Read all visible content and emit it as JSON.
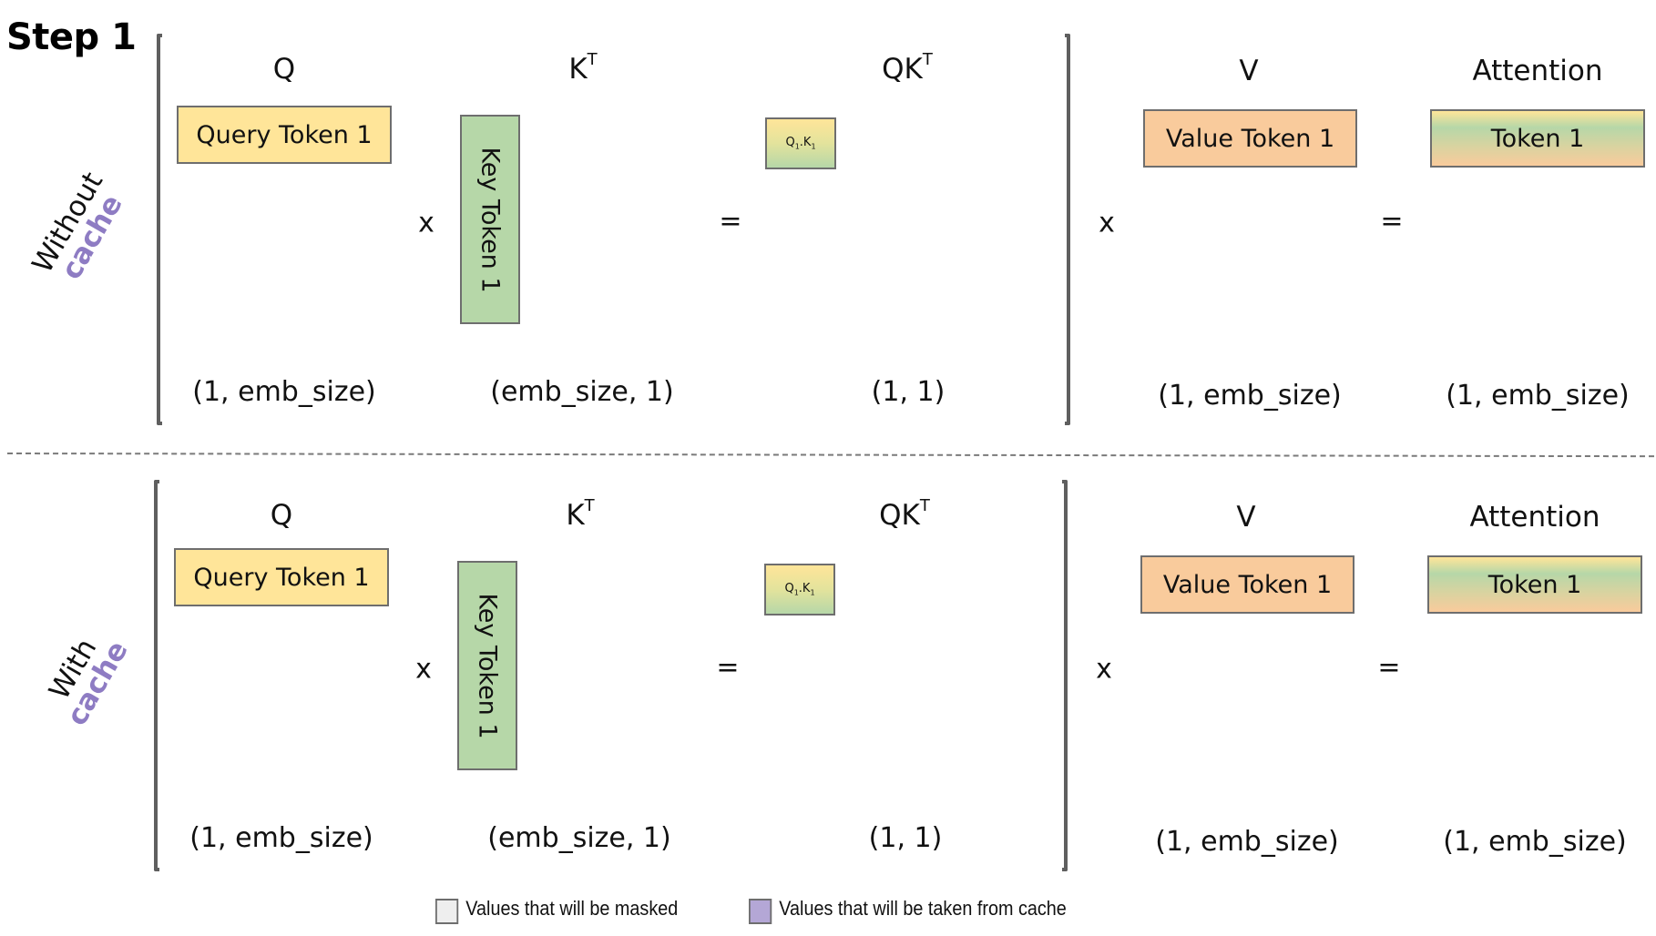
{
  "title": "Step 1",
  "colors": {
    "query": "#FFE599",
    "key": "#B6D7A8",
    "value": "#F9CB9C",
    "cache_accent": "#8E7CC3",
    "masked": "#EEEEEE",
    "from_cache": "#B4A7D6",
    "border": "#6E6E6E"
  },
  "panels": [
    {
      "id": "without-cache",
      "side_label": {
        "line1": "Without",
        "line2": "cache"
      },
      "q": {
        "header": "Q",
        "box_label": "Query Token 1",
        "dim": "(1, emb_size)"
      },
      "op_multiply_1": "x",
      "k": {
        "header_base": "K",
        "header_sup": "T",
        "box_label": "Key Token 1",
        "dim": "(emb_size, 1)"
      },
      "op_equals_1": "=",
      "qk": {
        "header_base": "QK",
        "header_sup": "T",
        "cell": {
          "q": "Q",
          "q_sub": "1",
          "sep": ".",
          "k": "K",
          "k_sub": "1"
        },
        "dim": "(1, 1)"
      },
      "op_multiply_2": "x",
      "v": {
        "header": "V",
        "box_label": "Value Token 1",
        "dim": "(1, emb_size)"
      },
      "op_equals_2": "=",
      "attention": {
        "header": "Attention",
        "box_label": "Token 1",
        "dim": "(1, emb_size)"
      }
    },
    {
      "id": "with-cache",
      "side_label": {
        "line1": "With",
        "line2": "cache"
      },
      "q": {
        "header": "Q",
        "box_label": "Query Token 1",
        "dim": "(1, emb_size)"
      },
      "op_multiply_1": "x",
      "k": {
        "header_base": "K",
        "header_sup": "T",
        "box_label": "Key Token 1",
        "dim": "(emb_size, 1)"
      },
      "op_equals_1": "=",
      "qk": {
        "header_base": "QK",
        "header_sup": "T",
        "cell": {
          "q": "Q",
          "q_sub": "1",
          "sep": ".",
          "k": "K",
          "k_sub": "1"
        },
        "dim": "(1, 1)"
      },
      "op_multiply_2": "x",
      "v": {
        "header": "V",
        "box_label": "Value Token 1",
        "dim": "(1, emb_size)"
      },
      "op_equals_2": "=",
      "attention": {
        "header": "Attention",
        "box_label": "Token 1",
        "dim": "(1, emb_size)"
      }
    }
  ],
  "legend": [
    {
      "label": "Values that will be masked",
      "swatch": "masked"
    },
    {
      "label": "Values that will be taken from cache",
      "swatch": "from_cache"
    }
  ]
}
